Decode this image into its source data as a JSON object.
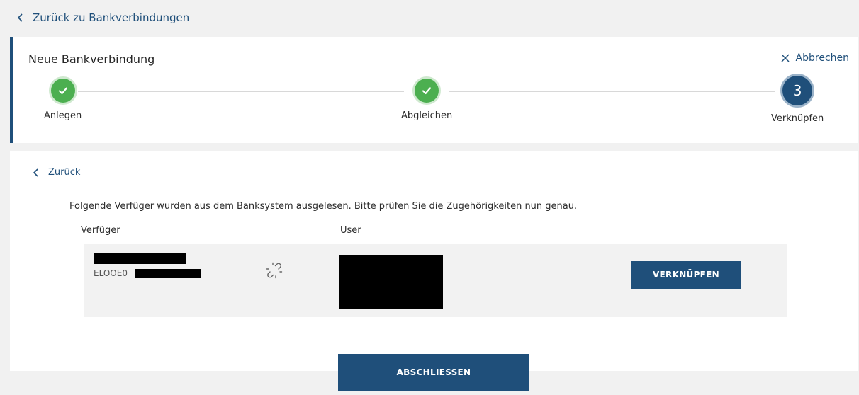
{
  "nav": {
    "back_label": "Zurück zu Bankverbindungen"
  },
  "stepper": {
    "title": "Neue Bankverbindung",
    "cancel_label": "Abbrechen",
    "steps": [
      {
        "label": "Anlegen",
        "state": "done"
      },
      {
        "label": "Abgleichen",
        "state": "done"
      },
      {
        "label": "Verknüpfen",
        "state": "active",
        "number": "3"
      }
    ]
  },
  "content": {
    "back_label": "Zurück",
    "instruction": "Folgende Verfüger wurden aus dem Banksystem ausgelesen. Bitte prüfen Sie die Zugehörigkeiten nun genau.",
    "columns": {
      "verfueger": "Verfüger",
      "user": "User"
    },
    "row": {
      "verfueger_id_prefix": "ELOOE0",
      "link_button_label": "VERKNÜPFEN"
    },
    "finish_label": "ABSCHLIESSEN"
  },
  "colors": {
    "primary": "#1f4f7a",
    "success": "#4caf50",
    "track": "#d8d8d8",
    "background": "#f1f1f1"
  }
}
